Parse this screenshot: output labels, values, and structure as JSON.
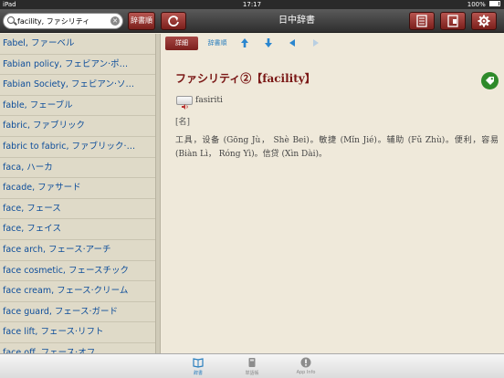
{
  "status": {
    "carrier": "iPad",
    "time": "17:17",
    "battery": "100%"
  },
  "toolbar": {
    "search_value": "facility, ファシリティ",
    "sort_label": "辞書順",
    "title": "日中辞書"
  },
  "list": {
    "items": [
      "Fabel, ファーベル",
      "Fabian policy, フェビアン·ポ…",
      "Fabian Society, フェビアン·ソ…",
      "fable, フェーブル",
      "fabric, ファブリック",
      "fabric to fabric, ファブリック·…",
      "faca, ハーカ",
      "facade, ファサード",
      "face, フェース",
      "face, フェイス",
      "face arch, フェース·アーチ",
      "face cosmetic, フェースチック",
      "face cream, フェース·クリーム",
      "face guard, フェース·ガード",
      "face lift, フェース·リフト",
      "face off, フェース·オフ"
    ]
  },
  "detail": {
    "tab_detail": "詳細",
    "tab_order": "辞書順",
    "headword": "ファシリティ②【facility】",
    "reading": "fasiriti",
    "pos": "[名]",
    "definition": "工具，设备 (Gōng Jù，  Shè Bei)。敏捷 (Mǐn Jié)。辅助 (Fǔ Zhù)。便利，容易 (Biàn Lì，  Róng Yì)。信贷 (Xìn Dài)。"
  },
  "tabbar": {
    "tabs": [
      {
        "label": "辞書",
        "icon": "book-open-icon"
      },
      {
        "label": "単語帳",
        "icon": "notebook-icon"
      },
      {
        "label": "App Info",
        "icon": "info-icon"
      }
    ]
  },
  "colors": {
    "accent": "#8a2a26",
    "link": "#0d4d9a",
    "tag": "#2e8a2a"
  }
}
